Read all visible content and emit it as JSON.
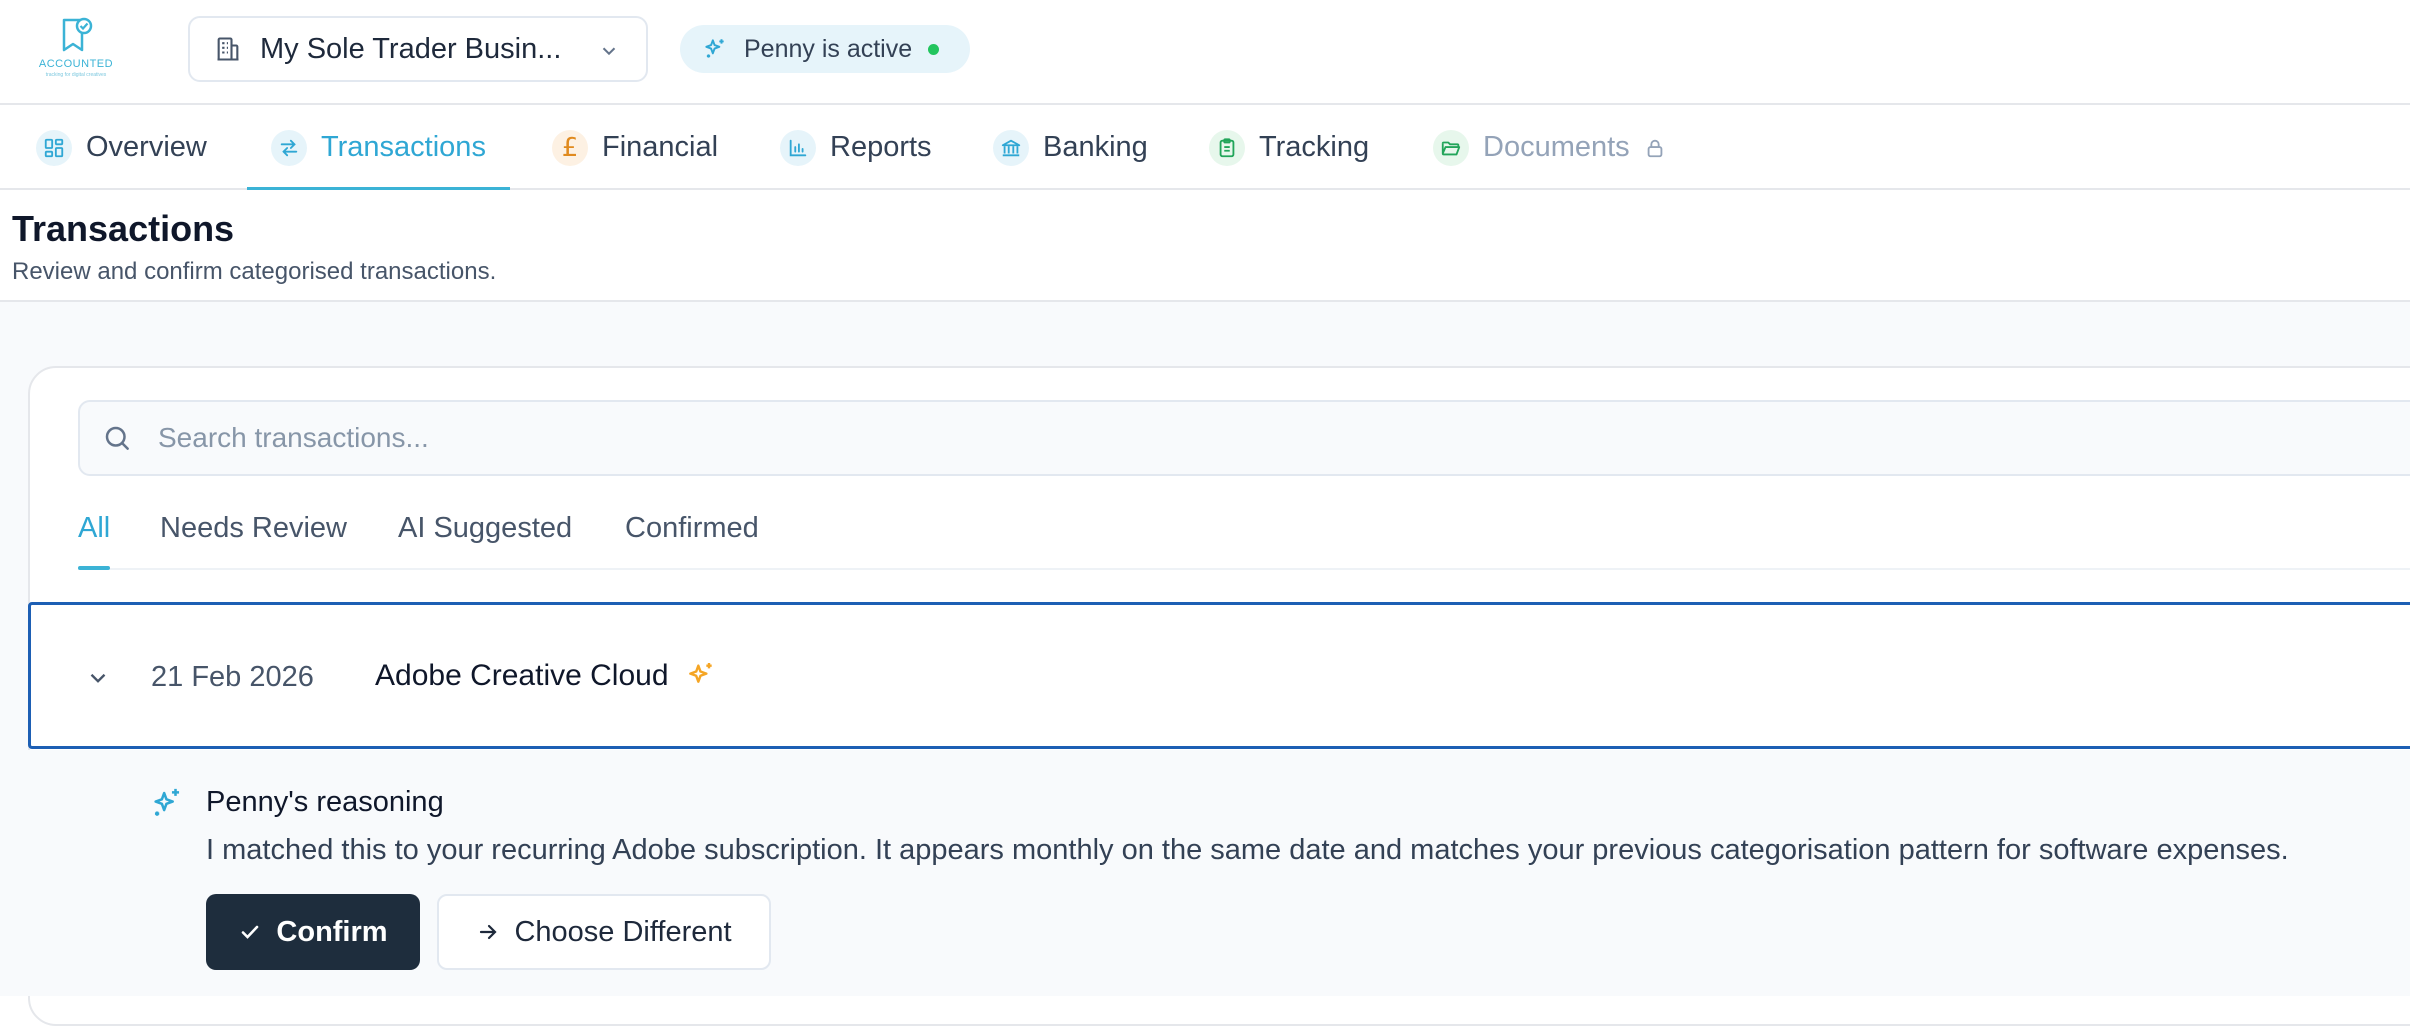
{
  "app": {
    "logo_text": "ACCOUNTED",
    "logo_tagline": "tracking for digital creatives",
    "business_selector": "My Sole Trader Busin...",
    "assistant_status": "Penny is active"
  },
  "nav": {
    "items": [
      {
        "label": "Overview",
        "icon": "grid-icon"
      },
      {
        "label": "Transactions",
        "icon": "swap-arrows-icon",
        "active": true
      },
      {
        "label": "Financial",
        "icon": "pound-icon"
      },
      {
        "label": "Reports",
        "icon": "bar-chart-icon"
      },
      {
        "label": "Banking",
        "icon": "bank-icon"
      },
      {
        "label": "Tracking",
        "icon": "clipboard-icon"
      },
      {
        "label": "Documents",
        "icon": "folder-icon",
        "locked": true
      }
    ]
  },
  "page": {
    "title": "Transactions",
    "subtitle": "Review and confirm categorised transactions."
  },
  "search": {
    "placeholder": "Search transactions..."
  },
  "filters": {
    "tabs": [
      "All",
      "Needs Review",
      "AI Suggested",
      "Confirmed"
    ],
    "active": "All"
  },
  "transaction": {
    "date": "21 Feb 2026",
    "name": "Adobe Creative Cloud",
    "reasoning_title": "Penny's reasoning",
    "reasoning_text": "I matched this to your recurring Adobe subscription. It appears monthly on the same date and matches your previous categorisation pattern for software expenses.",
    "confirm_label": "Confirm",
    "choose_label": "Choose Different"
  },
  "colors": {
    "accent": "#3bb3d6",
    "selected_border": "#1d5fb4",
    "dark_button": "#1e2d3d",
    "status_active": "#22c55e",
    "ai_spark": "#f5a524"
  }
}
